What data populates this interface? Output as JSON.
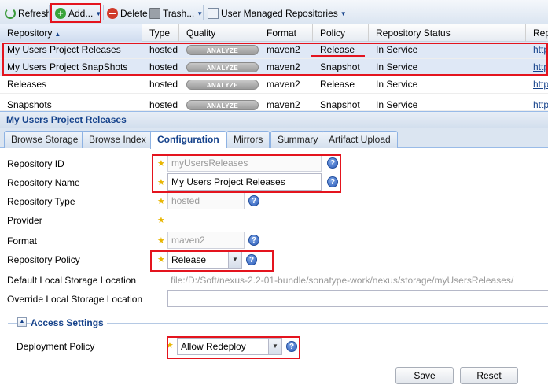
{
  "toolbar": {
    "refresh": "Refresh",
    "add": "Add...",
    "delete": "Delete",
    "trash": "Trash...",
    "user_managed": "User Managed Repositories"
  },
  "grid": {
    "headers": [
      "Repository",
      "Type",
      "Quality",
      "Format",
      "Policy",
      "Repository Status",
      "Repo"
    ],
    "rows": [
      {
        "name": "My Users Project Releases",
        "type": "hosted",
        "quality": "ANALYZE",
        "format": "maven2",
        "policy": "Release",
        "status": "In Service",
        "url": "http:"
      },
      {
        "name": "My Users Project SnapShots",
        "type": "hosted",
        "quality": "ANALYZE",
        "format": "maven2",
        "policy": "Snapshot",
        "status": "In Service",
        "url": "http:"
      },
      {
        "name": "Releases",
        "type": "hosted",
        "quality": "ANALYZE",
        "format": "maven2",
        "policy": "Release",
        "status": "In Service",
        "url": "http:"
      },
      {
        "name": "Snapshots",
        "type": "hosted",
        "quality": "ANALYZE",
        "format": "maven2",
        "policy": "Snapshot",
        "status": "In Service",
        "url": "http:"
      }
    ]
  },
  "panel": {
    "title": "My Users Project Releases",
    "tabs": [
      "Browse Storage",
      "Browse Index",
      "Configuration",
      "Mirrors",
      "Summary",
      "Artifact Upload"
    ],
    "active_tab": "Configuration"
  },
  "form": {
    "repo_id_label": "Repository ID",
    "repo_id_value": "myUsersReleases",
    "repo_name_label": "Repository Name",
    "repo_name_value": "My Users Project Releases",
    "repo_type_label": "Repository Type",
    "repo_type_value": "hosted",
    "provider_label": "Provider",
    "format_label": "Format",
    "format_value": "maven2",
    "policy_label": "Repository Policy",
    "policy_value": "Release",
    "default_storage_label": "Default Local Storage Location",
    "default_storage_value": "file:/D:/Soft/nexus-2.2-01-bundle/sonatype-work/nexus/storage/myUsersReleases/",
    "override_storage_label": "Override Local Storage Location",
    "override_storage_value": "",
    "access_settings_legend": "Access Settings",
    "deployment_policy_label": "Deployment Policy",
    "deployment_policy_value": "Allow Redeploy",
    "save": "Save",
    "reset": "Reset"
  },
  "icons": {
    "required": "star-icon",
    "help": "help-icon"
  },
  "colors": {
    "highlight": "#e4141e",
    "accent": "#15428b",
    "selected_row": "#dfe8f6"
  }
}
